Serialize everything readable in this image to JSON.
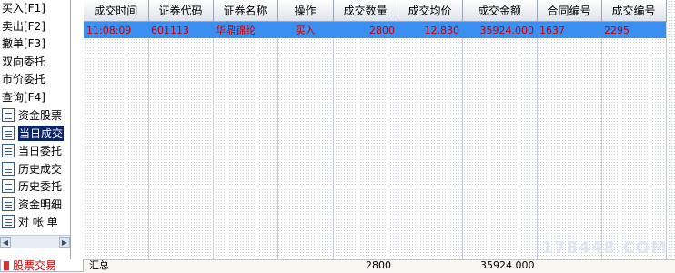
{
  "sidebar": {
    "menu": [
      {
        "label": "买入[F1]"
      },
      {
        "label": "卖出[F2]"
      },
      {
        "label": "撤单[F3]"
      },
      {
        "label": "双向委托"
      },
      {
        "label": "市价委托"
      },
      {
        "label": "查询[F4]"
      }
    ],
    "query_items": [
      {
        "label": "资金股票",
        "icon": "document-icon",
        "selected": false
      },
      {
        "label": "当日成交",
        "icon": "document-icon",
        "selected": true
      },
      {
        "label": "当日委托",
        "icon": "document-icon",
        "selected": false
      },
      {
        "label": "历史成交",
        "icon": "document-icon",
        "selected": false
      },
      {
        "label": "历史委托",
        "icon": "document-icon",
        "selected": false
      },
      {
        "label": "资金明细",
        "icon": "document-icon",
        "selected": false
      },
      {
        "label": "对 帐 单",
        "icon": "document-icon",
        "selected": false
      }
    ]
  },
  "tab": {
    "label": "股票交易",
    "color": "#d80000"
  },
  "table": {
    "columns": [
      "成交时间",
      "证券代码",
      "证券名称",
      "操作",
      "成交数量",
      "成交均价",
      "成交金额",
      "合同编号",
      "成交编号"
    ],
    "rows": [
      {
        "time": "11:08:09",
        "code": "601113",
        "name": "华鼎锦纶",
        "action": "买入",
        "qty": "2800",
        "avg_price": "12.830",
        "amount": "35924.000",
        "contract_no": "1637",
        "trade_no": "2295"
      }
    ],
    "selected_row_color": "#3b8ff0",
    "text_color": "#cc0000"
  },
  "summary": {
    "label": "汇总",
    "qty": "2800",
    "amount": "35924.000"
  },
  "watermark": "178448.COM"
}
